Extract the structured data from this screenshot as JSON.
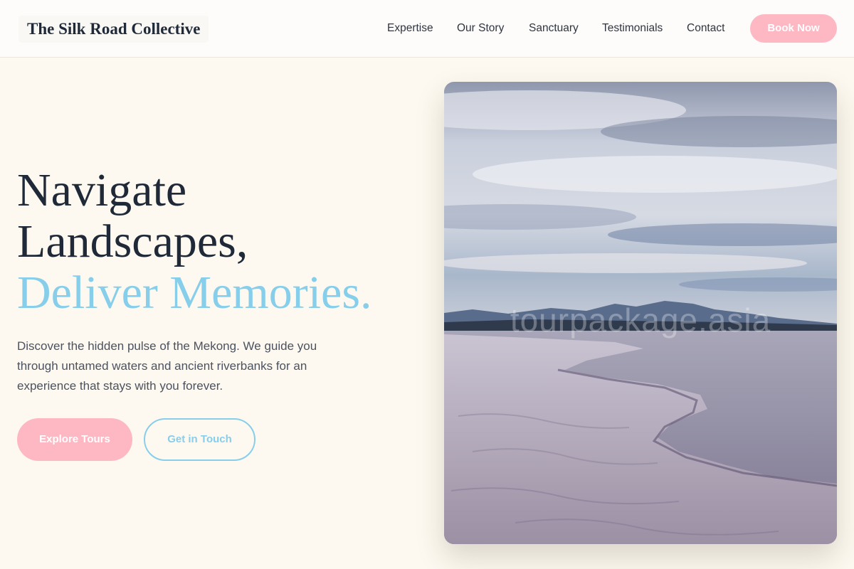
{
  "header": {
    "brand": "The Silk Road Collective",
    "nav": [
      {
        "label": "Expertise"
      },
      {
        "label": "Our Story"
      },
      {
        "label": "Sanctuary"
      },
      {
        "label": "Testimonials"
      },
      {
        "label": "Contact"
      }
    ],
    "book_label": "Book Now"
  },
  "hero": {
    "title_line1": "Navigate",
    "title_line2": "Landscapes,",
    "title_accent": "Deliver Memories.",
    "description": "Discover the hidden pulse of the Mekong. We guide you through untamed waters and ancient riverbanks for an experience that stays with you forever.",
    "primary_cta": "Explore Tours",
    "secondary_cta": "Get in Touch"
  },
  "image": {
    "watermark": "tourpackage.asia"
  },
  "colors": {
    "accent_pink": "#fdb8c3",
    "accent_blue": "#87ceeb",
    "background": "#fdf9f0",
    "text_dark": "#1f2937"
  }
}
